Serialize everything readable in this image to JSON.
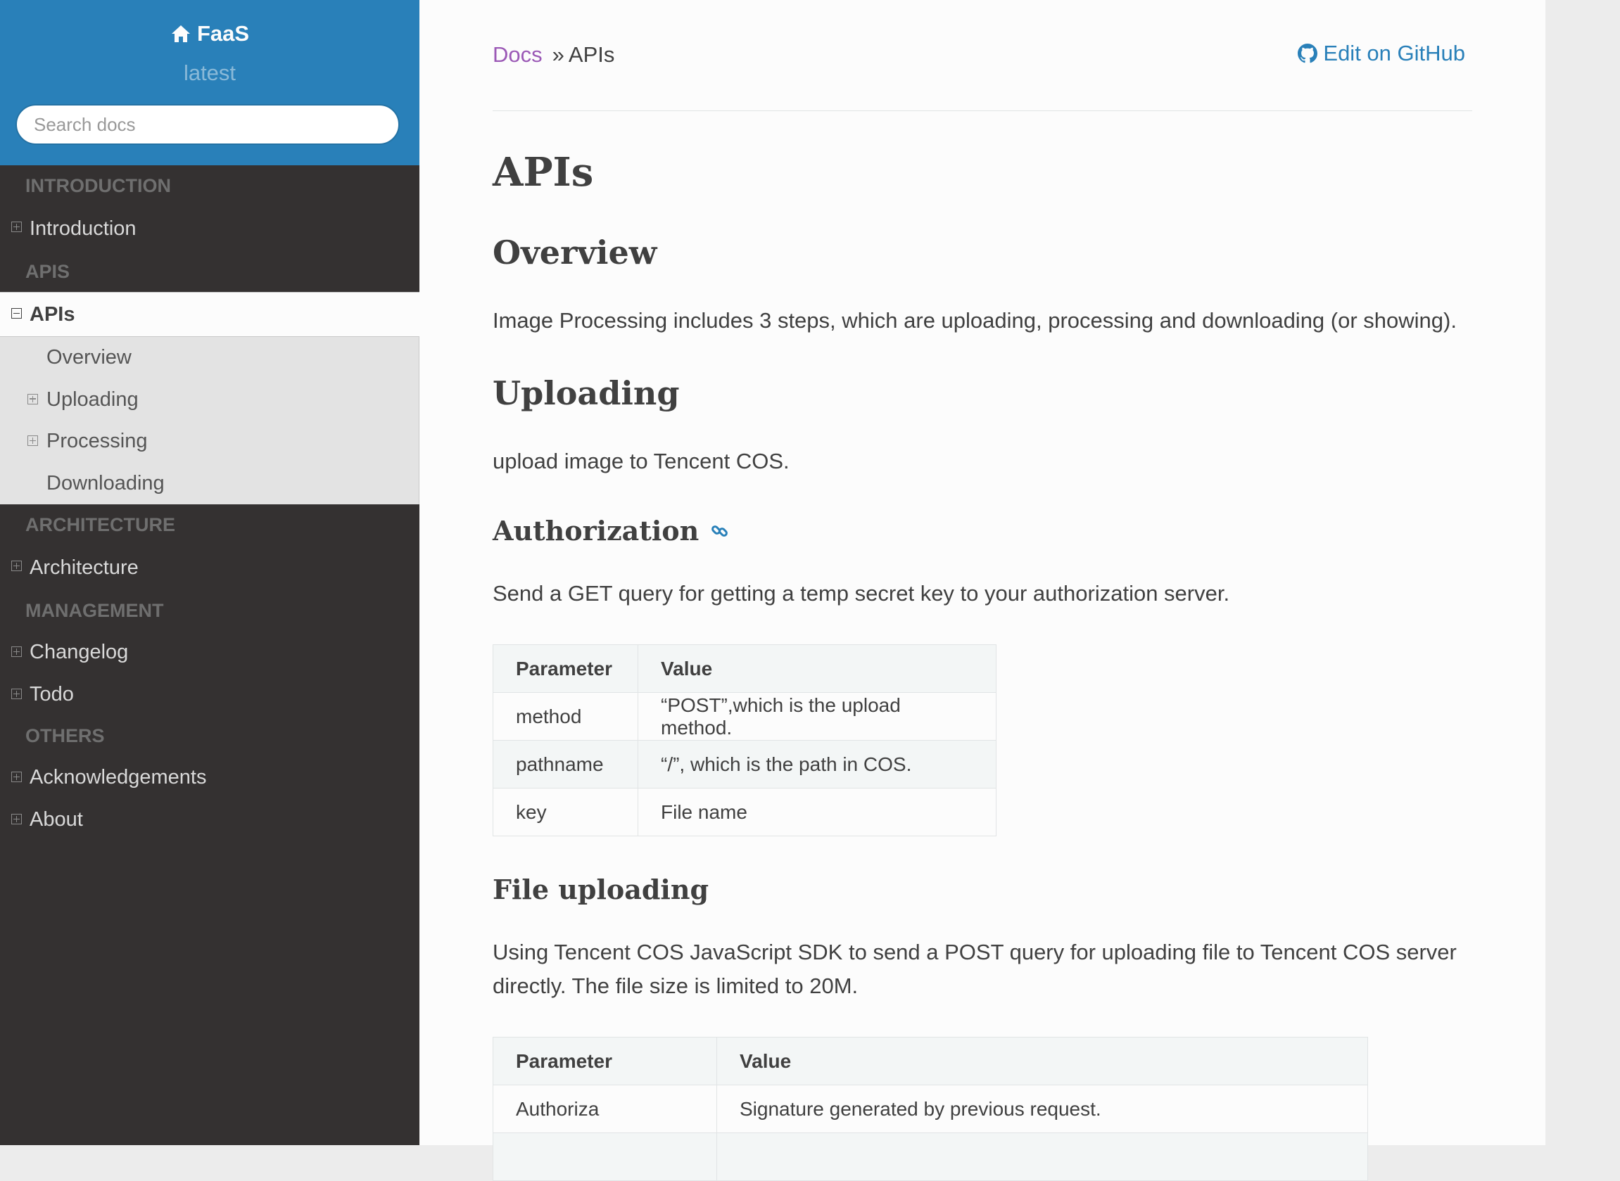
{
  "sidebar": {
    "project": "FaaS",
    "version": "latest",
    "search_placeholder": "Search docs",
    "sections": [
      {
        "caption": "INTRODUCTION",
        "items": [
          {
            "label": "Introduction"
          }
        ]
      },
      {
        "caption": "APIS",
        "items": [
          {
            "label": "APIs",
            "current": true,
            "children": [
              {
                "label": "Overview",
                "expandable": false
              },
              {
                "label": "Uploading",
                "expandable": true
              },
              {
                "label": "Processing",
                "expandable": true
              },
              {
                "label": "Downloading",
                "expandable": false
              }
            ]
          }
        ]
      },
      {
        "caption": "ARCHITECTURE",
        "items": [
          {
            "label": "Architecture"
          }
        ]
      },
      {
        "caption": "MANAGEMENT",
        "items": [
          {
            "label": "Changelog"
          },
          {
            "label": "Todo"
          }
        ]
      },
      {
        "caption": "OTHERS",
        "items": [
          {
            "label": "Acknowledgements"
          },
          {
            "label": "About"
          }
        ]
      }
    ]
  },
  "breadcrumb": {
    "docs": "Docs",
    "separator": "»",
    "current": "APIs"
  },
  "edit_link": "Edit on GitHub",
  "main": {
    "title": "APIs",
    "overview_heading": "Overview",
    "overview_text": "Image Processing includes 3 steps, which are uploading, processing and downloading (or showing).",
    "uploading_heading": "Uploading",
    "uploading_text": "upload image to Tencent COS.",
    "auth_heading": "Authorization",
    "auth_text": "Send a GET query for getting a temp secret key to your authorization server.",
    "auth_table": {
      "headers": [
        "Parameter",
        "Value"
      ],
      "rows": [
        [
          "method",
          "“POST”,which is the upload method."
        ],
        [
          "pathname",
          "“/”, which is the path in COS."
        ],
        [
          "key",
          "File name"
        ]
      ]
    },
    "file_heading": "File uploading",
    "file_text": "Using Tencent COS JavaScript SDK to send a POST query for uploading file to Tencent COS server directly. The file size is limited to 20M.",
    "file_table": {
      "headers": [
        "Parameter",
        "Value"
      ],
      "rows": [
        [
          "Authoriza",
          "Signature generated by previous request."
        ],
        [
          "",
          ""
        ]
      ]
    }
  },
  "colors": {
    "sidebar_top": "#2980b9",
    "sidebar_bg": "#343131",
    "link": "#2980b9",
    "visited_link": "#9b59b6"
  },
  "icons": {
    "home": "home-icon",
    "github": "github-icon",
    "permalink": "link-icon"
  }
}
